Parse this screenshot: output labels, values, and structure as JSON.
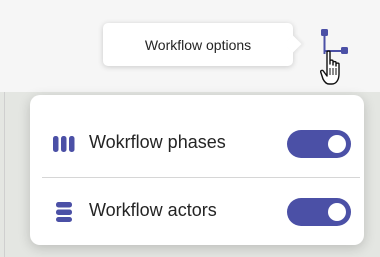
{
  "tooltip": {
    "text": "Workflow options"
  },
  "workflow_button": {
    "icon": "workflow-branch-icon",
    "cursor": "hand-pointer-cursor-icon"
  },
  "menu": {
    "items": [
      {
        "label": "Wokrflow phases",
        "icon": "phases-columns-icon",
        "toggle_on": true
      },
      {
        "label": "Workflow actors",
        "icon": "actors-rows-icon",
        "toggle_on": true
      }
    ]
  },
  "colors": {
    "accent": "#4b50a6",
    "text": "#242424",
    "menu_bg": "#ffffff",
    "topbar_bg": "#f6f6f6"
  }
}
